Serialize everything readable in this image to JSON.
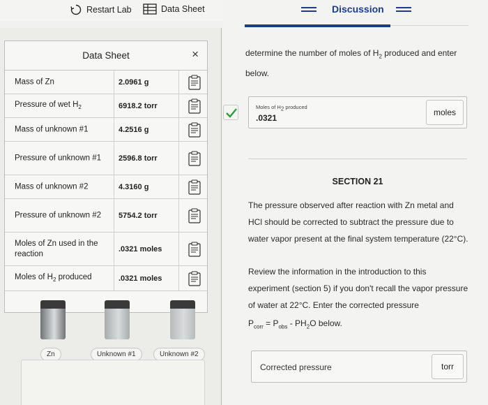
{
  "toolbar": {
    "restart_label": "Restart Lab",
    "datasheet_label": "Data Sheet"
  },
  "data_sheet": {
    "title": "Data Sheet",
    "close_glyph": "×",
    "rows": [
      {
        "label_pre": "Mass of Zn",
        "label_sub": "",
        "value": "2.0961 g"
      },
      {
        "label_pre": "Pressure of wet H",
        "label_sub": "2",
        "value": "6918.2 torr"
      },
      {
        "label_pre": "Mass of unknown #1",
        "label_sub": "",
        "value": "4.2516 g"
      },
      {
        "label_pre": "Pressure of unknown #1",
        "label_sub": "",
        "value": "2596.8 torr"
      },
      {
        "label_pre": "Mass of unknown #2",
        "label_sub": "",
        "value": "4.3160 g"
      },
      {
        "label_pre": "Pressure of unknown #2",
        "label_sub": "",
        "value": "5754.2 torr"
      },
      {
        "label_pre": "Moles of Zn used in the reaction",
        "label_sub": "",
        "value": ".0321 moles"
      },
      {
        "label_pre": "Moles of H",
        "label_sub": "2",
        "label_post": " produced",
        "value": ".0321 moles"
      }
    ]
  },
  "bottles": [
    {
      "label": "Zn",
      "fill_color": "#6f7274"
    },
    {
      "label": "Unknown #1",
      "fill_color": "#a9acad"
    },
    {
      "label": "Unknown #2",
      "fill_color": "#b7babb"
    }
  ],
  "discussion": {
    "tab_label": "Discussion",
    "intro_pre": "determine the number of moles of H",
    "intro_sub": "2",
    "intro_post": " produced and enter below.",
    "answer_label_pre": "Moles of H",
    "answer_label_sub": "2",
    "answer_label_post": " produced",
    "answer_value": ".0321",
    "answer_unit": "moles",
    "section_title": "SECTION 21",
    "para1": "The pressure observed after reaction with Zn metal and HCl should be corrected to subtract the pressure due to water vapor present at the final system temperature (22°C).",
    "para2": "Review the information in the introduction to this experiment (section 5) if you don't recall the vapor pressure of water at 22°C. Enter the corrected pressure",
    "formula_p": "P",
    "formula_corr": "corr",
    "formula_eq": " = P",
    "formula_obs": "obs",
    "formula_minus": " - PH",
    "formula_2": "2",
    "formula_tail": "O below.",
    "corrected_label": "Corrected pressure",
    "corrected_unit": "torr"
  },
  "colors": {
    "accent": "#1f3b8c",
    "check_green": "#2e9e3a"
  }
}
